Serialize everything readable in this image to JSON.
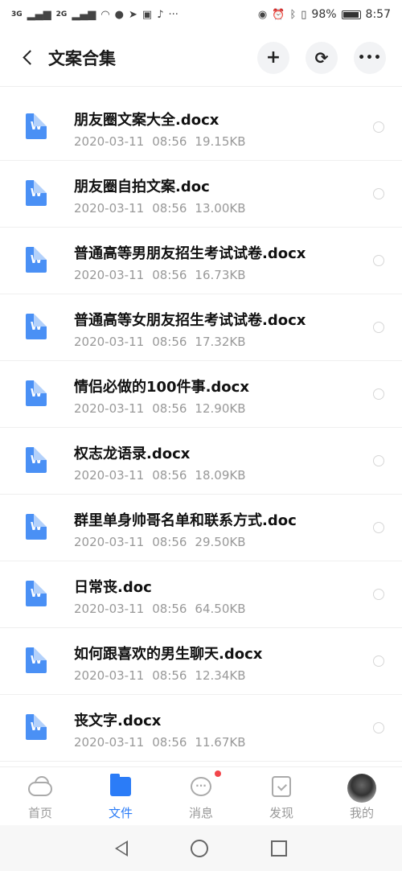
{
  "status": {
    "signal1": "3G",
    "signal2": "2G",
    "battery": "98%",
    "time": "8:57"
  },
  "header": {
    "title": "文案合集",
    "add_icon": "+",
    "more_icon": "•••"
  },
  "files": [
    {
      "name": "朋友圈文案大全.docx",
      "date": "2020-03-11",
      "time": "08:56",
      "size": "19.15KB"
    },
    {
      "name": "朋友圈自拍文案.doc",
      "date": "2020-03-11",
      "time": "08:56",
      "size": "13.00KB"
    },
    {
      "name": "普通高等男朋友招生考试试卷.docx",
      "date": "2020-03-11",
      "time": "08:56",
      "size": "16.73KB"
    },
    {
      "name": "普通高等女朋友招生考试试卷.docx",
      "date": "2020-03-11",
      "time": "08:56",
      "size": "17.32KB"
    },
    {
      "name": "情侣必做的100件事.docx",
      "date": "2020-03-11",
      "time": "08:56",
      "size": "12.90KB"
    },
    {
      "name": "权志龙语录.docx",
      "date": "2020-03-11",
      "time": "08:56",
      "size": "18.09KB"
    },
    {
      "name": "群里单身帅哥名单和联系方式.doc",
      "date": "2020-03-11",
      "time": "08:56",
      "size": "29.50KB"
    },
    {
      "name": "日常丧.doc",
      "date": "2020-03-11",
      "time": "08:56",
      "size": "64.50KB"
    },
    {
      "name": "如何跟喜欢的男生聊天.docx",
      "date": "2020-03-11",
      "time": "08:56",
      "size": "12.34KB"
    },
    {
      "name": "丧文字.docx",
      "date": "2020-03-11",
      "time": "08:56",
      "size": "11.67KB"
    }
  ],
  "doc_icon_letter": "W",
  "nav": {
    "home": "首页",
    "files": "文件",
    "messages": "消息",
    "discover": "发现",
    "mine": "我的"
  },
  "colors": {
    "accent": "#2b7cf7",
    "doc_icon": "#4a90f5",
    "badge": "#f2464b"
  }
}
